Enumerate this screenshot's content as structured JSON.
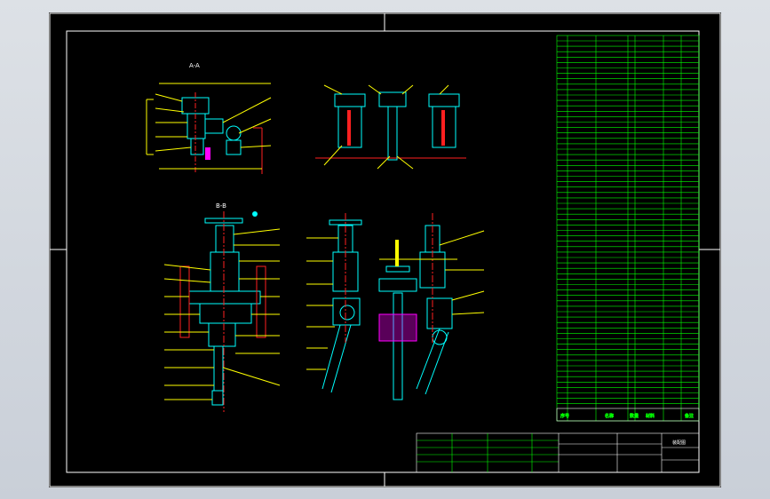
{
  "section_labels": {
    "top_left": "A-A",
    "bottom_left": "B-B"
  },
  "parts_table_header": {
    "col_no": "序号",
    "col_name": "名称",
    "col_qty": "数量",
    "col_mat": "材料",
    "col_remark": "备注"
  },
  "title_block": {
    "drawing_name": "装配图"
  },
  "colors": {
    "line": "#ffffff",
    "part": "#00ffff",
    "accent": "#ffff00",
    "hatch": "#ff2020",
    "magenta": "#ff00ff",
    "table": "#00ff00"
  },
  "icons": [
    "handwheel-icon",
    "clamp-arm-icon",
    "cylinder-icon"
  ]
}
